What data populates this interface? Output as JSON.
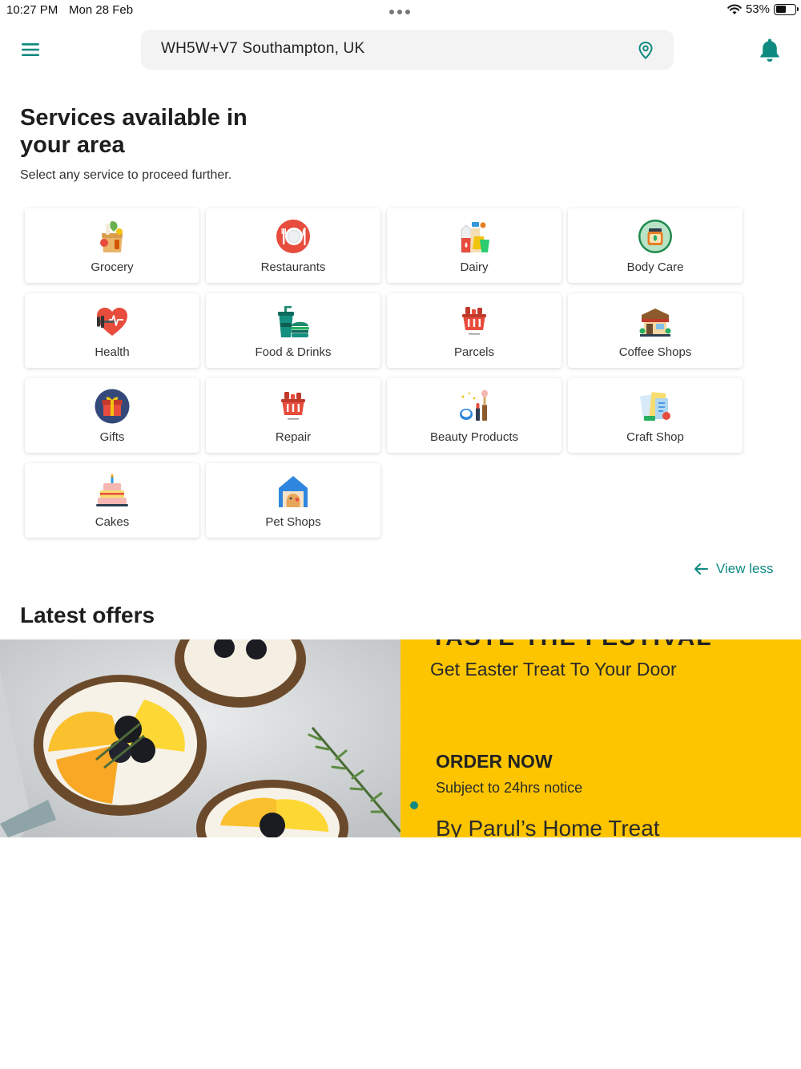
{
  "status_bar": {
    "time": "10:27 PM",
    "date": "Mon 28 Feb",
    "battery": "53%"
  },
  "header": {
    "location": "WH5W+V7 Southampton, UK"
  },
  "services": {
    "title": "Services available in your area",
    "subtitle": "Select any service to proceed further.",
    "items": [
      {
        "label": "Grocery",
        "icon": "grocery-bag-icon"
      },
      {
        "label": "Restaurants",
        "icon": "plate-cutlery-icon"
      },
      {
        "label": "Dairy",
        "icon": "dairy-bottles-icon"
      },
      {
        "label": "Body Care",
        "icon": "body-care-jar-icon"
      },
      {
        "label": "Health",
        "icon": "heart-dumbbell-icon"
      },
      {
        "label": "Food & Drinks",
        "icon": "burger-drink-icon"
      },
      {
        "label": "Parcels",
        "icon": "basket-icon"
      },
      {
        "label": "Coffee Shops",
        "icon": "coffee-shop-icon"
      },
      {
        "label": "Gifts",
        "icon": "gift-icon"
      },
      {
        "label": "Repair",
        "icon": "basket-icon"
      },
      {
        "label": "Beauty Products",
        "icon": "cosmetics-icon"
      },
      {
        "label": "Craft Shop",
        "icon": "craft-papers-icon"
      },
      {
        "label": "Cakes",
        "icon": "cake-icon"
      },
      {
        "label": "Pet Shops",
        "icon": "pet-house-icon"
      }
    ],
    "view_less": "View less"
  },
  "offers": {
    "title": "Latest offers",
    "banner": {
      "top_text": "TASTE THE FESTIVAL",
      "headline": "Get Easter Treat To Your Door",
      "cta": "ORDER NOW",
      "note": "Subject to 24hrs notice",
      "by": "By Parul’s Home Treat"
    }
  },
  "colors": {
    "accent": "#0f8a80",
    "banner_yellow": "#fdc500"
  }
}
